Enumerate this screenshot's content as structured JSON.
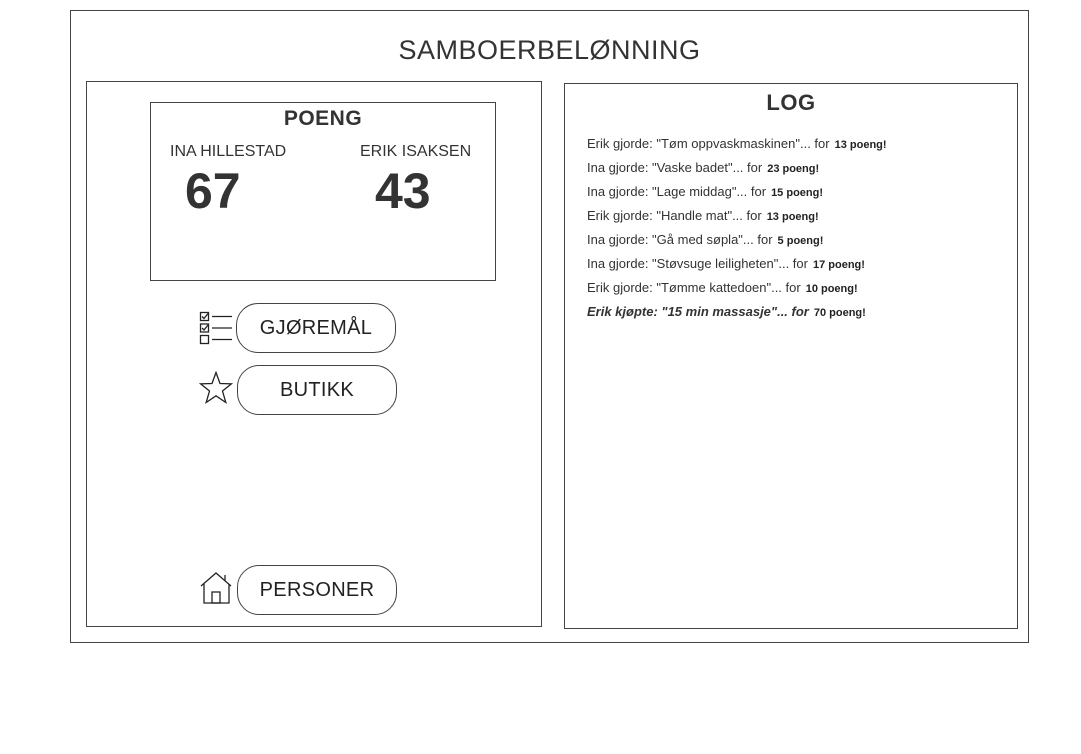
{
  "app": {
    "title": "SAMBOERBELØNNING"
  },
  "scores": {
    "title": "POENG",
    "people": [
      {
        "name": "INA HILLESTAD",
        "score": "67"
      },
      {
        "name": "ERIK ISAKSEN",
        "score": "43"
      }
    ]
  },
  "nav": {
    "chores": {
      "label": "GJØREMÅL",
      "icon": "checklist-icon"
    },
    "shop": {
      "label": "BUTIKK",
      "icon": "star-icon"
    },
    "people": {
      "label": "PERSONER",
      "icon": "house-icon"
    }
  },
  "log": {
    "title": "LOG",
    "entries": [
      {
        "text": "Erik gjorde: \"Tøm oppvaskmaskinen\"... for",
        "points": "13 poeng!"
      },
      {
        "text": "Ina gjorde: \"Vaske badet\"... for",
        "points": "23 poeng!"
      },
      {
        "text": "Ina gjorde: \"Lage middag\"... for",
        "points": "15 poeng!"
      },
      {
        "text": "Erik gjorde: \"Handle mat\"... for",
        "points": "13 poeng!"
      },
      {
        "text": "Ina gjorde: \"Gå med søpla\"... for",
        "points": "5 poeng!"
      },
      {
        "text": "Ina gjorde: \"Støvsuge leiligheten\"... for",
        "points": "17 poeng!"
      },
      {
        "text": "Erik gjorde: \"Tømme kattedoen\"... for",
        "points": "10 poeng!"
      },
      {
        "text": "Erik kjøpte: \"15 min massasje\"... for",
        "points": "70 poeng!"
      }
    ]
  }
}
